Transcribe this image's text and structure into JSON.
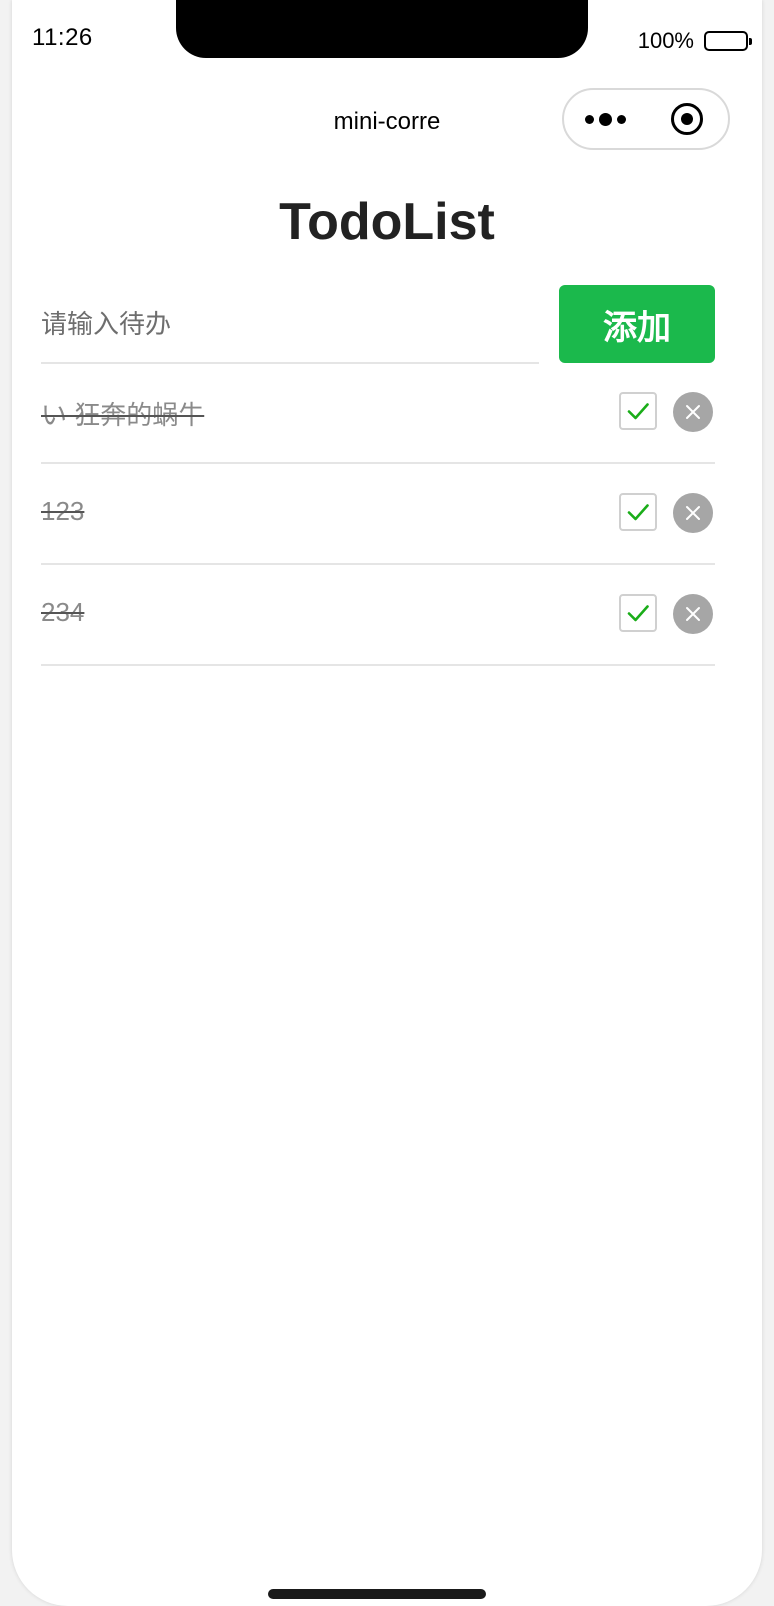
{
  "status_bar": {
    "time": "11:26",
    "battery_percent": "100%"
  },
  "nav": {
    "title": "mini-corre"
  },
  "page": {
    "title": "TodoList"
  },
  "input": {
    "placeholder": "请输入待办",
    "value": ""
  },
  "add_button": {
    "label": "添加"
  },
  "todos": [
    {
      "text": "い 狂奔的蜗牛",
      "done": true
    },
    {
      "text": "123",
      "done": true
    },
    {
      "text": "234",
      "done": true
    }
  ],
  "icons": {
    "check": "checkmark-icon",
    "delete": "close-circle-icon"
  },
  "colors": {
    "accent": "#1bb94c",
    "check": "#1aad19",
    "delete_bg": "#a6a6a6",
    "done_text": "#8a8a8a"
  }
}
